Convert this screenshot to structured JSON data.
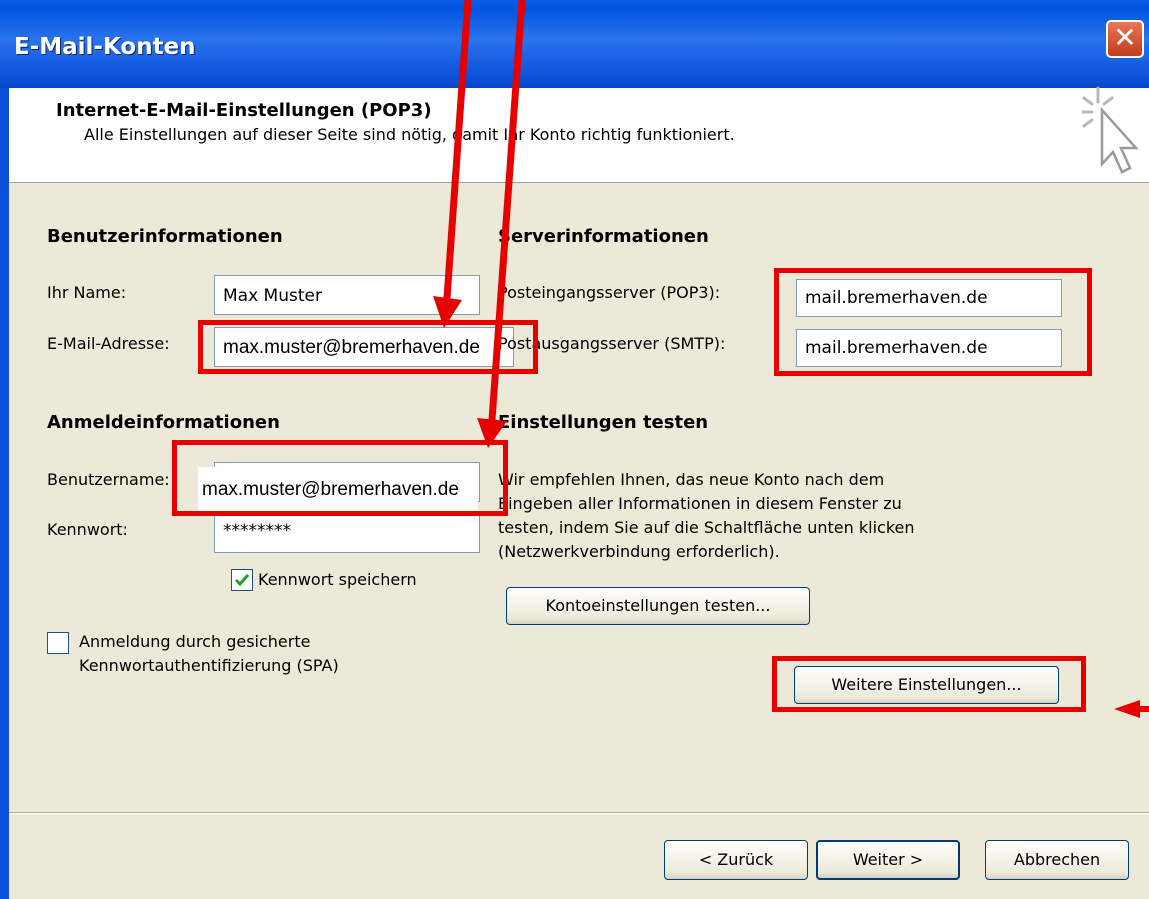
{
  "window": {
    "title": "E-Mail-Konten",
    "close_glyph": "✕"
  },
  "header": {
    "title": "Internet-E-Mail-Einstellungen (POP3)",
    "subtitle": "Alle Einstellungen auf dieser Seite sind nötig, damit Ihr Konto richtig funktioniert.",
    "icon": "cursor-sparkle-icon"
  },
  "user_info": {
    "heading": "Benutzerinformationen",
    "name_label": "Ihr Name:",
    "name_value": "Max Muster",
    "email_label": "E-Mail-Adresse:",
    "email_value": "max.muster@bremerhaven.de"
  },
  "server_info": {
    "heading": "Serverinformationen",
    "incoming_label": "Posteingangsserver (POP3):",
    "incoming_value": "mail.bremerhaven.de",
    "outgoing_label": "Postausgangsserver (SMTP):",
    "outgoing_value": "mail.bremerhaven.de"
  },
  "login_info": {
    "heading": "Anmeldeinformationen",
    "username_label": "Benutzername:",
    "username_value": "max.muster@bremerhaven.de",
    "password_label": "Kennwort:",
    "password_value": "********",
    "remember_label": "Kennwort speichern",
    "remember_checked": true,
    "spa_label_1": "Anmeldung durch gesicherte",
    "spa_label_2": "Kennwortauthentifizierung (SPA)",
    "spa_checked": false
  },
  "test_settings": {
    "heading": "Einstellungen testen",
    "text_1": "Wir empfehlen Ihnen, das neue Konto nach dem",
    "text_2": "Eingeben aller Informationen in diesem Fenster zu",
    "text_3": "testen, indem Sie auf die Schaltfläche unten klicken",
    "text_4": "(Netzwerkverbindung erforderlich).",
    "test_button": "Kontoeinstellungen testen...",
    "more_button": "Weitere Einstellungen..."
  },
  "footer": {
    "back": "< Zurück",
    "next": "Weiter >",
    "cancel": "Abbrechen"
  },
  "colors": {
    "annotation_red": "#e60000",
    "title_blue": "#0054e3",
    "dialog_bg": "#ece9d8"
  }
}
